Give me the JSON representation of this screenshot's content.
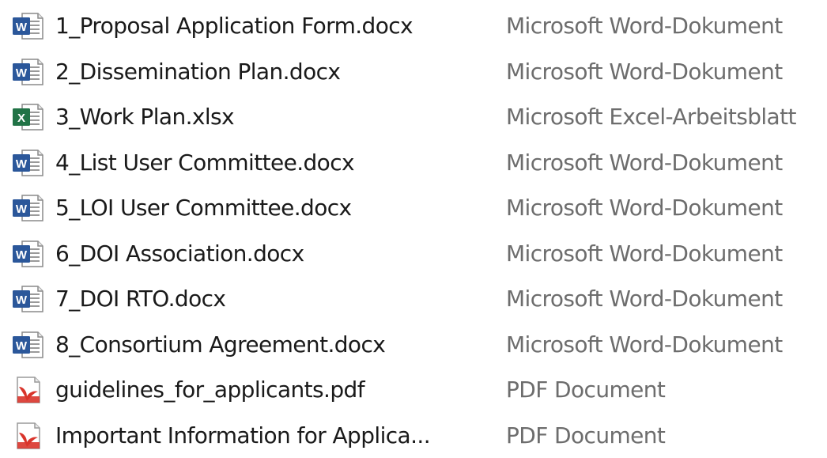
{
  "files": [
    {
      "name": "1_Proposal Application Form.docx",
      "type": "Microsoft Word-Dokument",
      "icon": "word-doc-icon"
    },
    {
      "name": "2_Dissemination Plan.docx",
      "type": "Microsoft Word-Dokument",
      "icon": "word-doc-icon"
    },
    {
      "name": "3_Work Plan.xlsx",
      "type": "Microsoft Excel-Arbeitsblatt",
      "icon": "excel-sheet-icon"
    },
    {
      "name": "4_List User Committee.docx",
      "type": "Microsoft Word-Dokument",
      "icon": "word-doc-icon"
    },
    {
      "name": "5_LOI User Committee.docx",
      "type": "Microsoft Word-Dokument",
      "icon": "word-doc-icon"
    },
    {
      "name": "6_DOI Association.docx",
      "type": "Microsoft Word-Dokument",
      "icon": "word-doc-icon"
    },
    {
      "name": "7_DOI RTO.docx",
      "type": "Microsoft Word-Dokument",
      "icon": "word-doc-icon"
    },
    {
      "name": "8_Consortium Agreement.docx",
      "type": "Microsoft Word-Dokument",
      "icon": "word-doc-icon"
    },
    {
      "name": "guidelines_for_applicants.pdf",
      "type": "PDF Document",
      "icon": "pdf-doc-icon"
    },
    {
      "name": "Important Information for Applica...",
      "type": "PDF Document",
      "icon": "pdf-doc-icon"
    }
  ],
  "colors": {
    "word": "#2b579a",
    "excel": "#217346",
    "pdf": "#d9342b",
    "name_text": "#1a1a1a",
    "type_text": "#6d6d6d"
  }
}
